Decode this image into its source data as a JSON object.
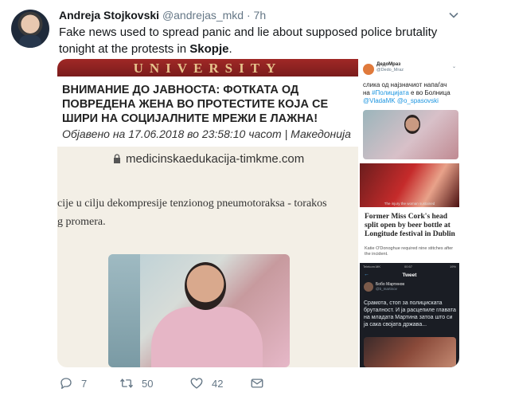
{
  "tweet": {
    "name": "Andreja Stojkovski",
    "handle": "@andrejas_mkd",
    "separator": "·",
    "time": "7h",
    "text_before": "Fake news used to spread panic and lie about supposed police brutality tonight at the protests in ",
    "text_bold": "Skopje",
    "text_after": "."
  },
  "left_image": {
    "banner": "UNIVERSITY",
    "headline": "ВНИМАНИЕ ДО ЈАВНОСТА: ФОТКАТА ОД ПОВРЕДЕНА ЖЕНА ВО ПРОТЕСТИТЕ КОЈА СЕ ШИРИ НА СОЦИЈАЛНИТЕ МРЕЖИ Е ЛАЖНА!",
    "dateline": "Објавено на 17.06.2018 во 23:58:10 часот | Македонија",
    "site": "medicinskaedukacija-timkme.com",
    "article_line1": "cije u cilju dekompresije tenzionog pneumotoraksa - torakos",
    "article_line2": "g promera."
  },
  "right_image_1": {
    "name": "ДедоМраз",
    "handle": "@Dedo_Mraz",
    "text_1": "слика од најзначиот напаѓач",
    "text_2_prefix": "на ",
    "text_2_link": "#Полицијата",
    "text_2_suffix": " е во Болница",
    "text_3_link_a": "@VladaMK",
    "text_3_link_b": " @o_spasovski"
  },
  "right_image_2": {
    "caption": "The injury the woman sustained",
    "headline": "Former Miss Cork's head split open by beer bottle at Longitude festival in Dublin",
    "sub": "Katie O'Donoghue required nine stitches after the incident."
  },
  "right_image_3": {
    "status_left": "Telekom.MK",
    "status_mid": "00:57",
    "status_right": "19%",
    "back": "←",
    "title": "Tweet",
    "name": "Бобо Мартинов",
    "handle": "@b_martinov",
    "text": "Срамота, стоп за полициската бруталност. И ја расцепиле главата на младата Мартина затоа што си ја сака својата држава..."
  },
  "actions": {
    "reply_count": "7",
    "retweet_count": "50",
    "like_count": "42"
  },
  "colors": {
    "text_primary": "#14171a",
    "text_secondary": "#657786",
    "link": "#1b95e0",
    "banner": "#a02826"
  }
}
